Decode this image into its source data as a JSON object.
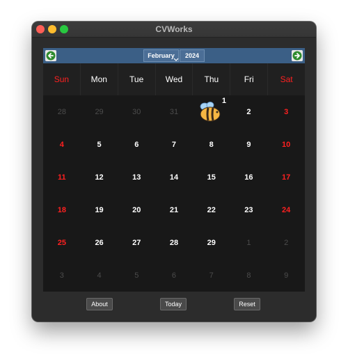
{
  "window": {
    "title": "CVWorks"
  },
  "nav": {
    "prev_icon": "arrow-left-icon",
    "next_icon": "arrow-right-icon",
    "month": "February",
    "year": "2024"
  },
  "weekdays": [
    {
      "label": "Sun",
      "weekend": true
    },
    {
      "label": "Mon",
      "weekend": false
    },
    {
      "label": "Tue",
      "weekend": false
    },
    {
      "label": "Wed",
      "weekend": false
    },
    {
      "label": "Thu",
      "weekend": false
    },
    {
      "label": "Fri",
      "weekend": false
    },
    {
      "label": "Sat",
      "weekend": true
    }
  ],
  "days": [
    {
      "label": "28",
      "other": true
    },
    {
      "label": "29",
      "other": true
    },
    {
      "label": "30",
      "other": true
    },
    {
      "label": "31",
      "other": true
    },
    {
      "label": "1",
      "today": true
    },
    {
      "label": "2"
    },
    {
      "label": "3"
    },
    {
      "label": "4"
    },
    {
      "label": "5"
    },
    {
      "label": "6"
    },
    {
      "label": "7"
    },
    {
      "label": "8"
    },
    {
      "label": "9"
    },
    {
      "label": "10"
    },
    {
      "label": "11"
    },
    {
      "label": "12"
    },
    {
      "label": "13"
    },
    {
      "label": "14"
    },
    {
      "label": "15"
    },
    {
      "label": "16"
    },
    {
      "label": "17"
    },
    {
      "label": "18"
    },
    {
      "label": "19"
    },
    {
      "label": "20"
    },
    {
      "label": "21"
    },
    {
      "label": "22"
    },
    {
      "label": "23"
    },
    {
      "label": "24"
    },
    {
      "label": "25"
    },
    {
      "label": "26"
    },
    {
      "label": "27"
    },
    {
      "label": "28"
    },
    {
      "label": "29"
    },
    {
      "label": "1",
      "other": true
    },
    {
      "label": "2",
      "other": true
    },
    {
      "label": "3",
      "other": true
    },
    {
      "label": "4",
      "other": true
    },
    {
      "label": "5",
      "other": true
    },
    {
      "label": "6",
      "other": true
    },
    {
      "label": "7",
      "other": true
    },
    {
      "label": "8",
      "other": true
    },
    {
      "label": "9",
      "other": true
    }
  ],
  "today_marker": {
    "icon": "bee-icon",
    "badge": "1"
  },
  "buttons": {
    "about": "About",
    "today": "Today",
    "reset": "Reset"
  },
  "colors": {
    "weekend": "#ff2020",
    "other_month": "#4c4c4c",
    "navbar": "#3b5f86",
    "nav_arrow": "#2e8b2e"
  }
}
